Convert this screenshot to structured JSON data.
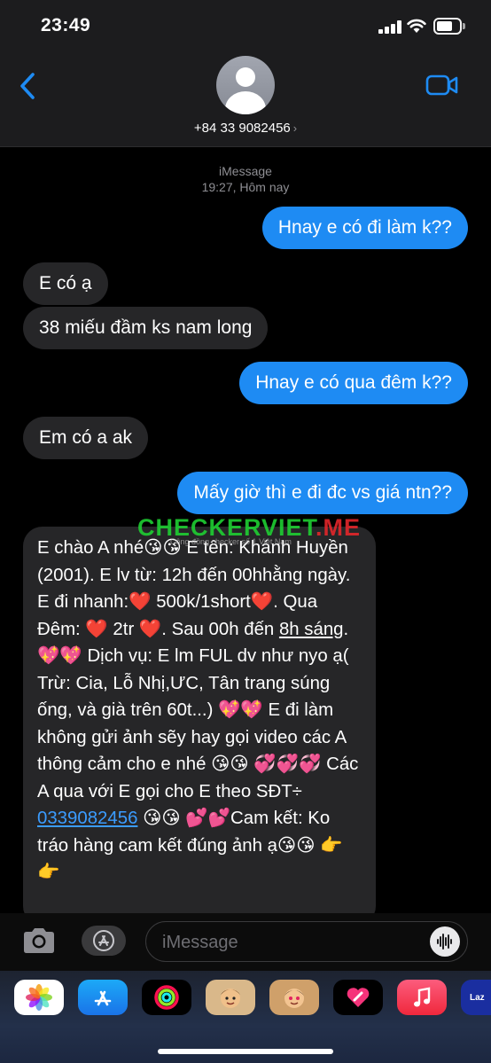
{
  "status": {
    "time": "23:49"
  },
  "header": {
    "phone": "+84 33 9082456",
    "chevron": "›"
  },
  "meta": {
    "service": "iMessage",
    "timestamp": "19:27, Hôm nay"
  },
  "messages": [
    {
      "text": "Hnay e có đi làm k??"
    },
    {
      "text": "E có ạ"
    },
    {
      "text": "38 miếu đầm ks nam long"
    },
    {
      "text": "Hnay e có qua đêm k??"
    },
    {
      "text": "Em có a ak"
    },
    {
      "text": "Mấy giờ thì e đi đc vs giá ntn??"
    }
  ],
  "long_message": {
    "part1": "E chào A nhé😘😘 E tên: Khánh Huyền (2001). E lv từ: 12h đến 00hhằng ngày. E đi nhanh:❤️ 500k/1short❤️. Qua Đêm: ❤️ 2tr ❤️. Sau 00h đến ",
    "underlined": "8h sáng",
    "part2": ". 💖💖 Dịch vụ: E lm FUL dv như nyo ạ( Trừ: Cia, Lỗ Nhị,ƯC, Tân trang súng ống, và già trên 60t...) 💖💖 E đi làm không gửi ảnh sẽy hay gọi video các A thông cảm cho e nhé 😘😘 💞💞💞 Các A qua với E gọi cho E theo SĐT÷ ",
    "phone": "0339082456",
    "part3": " 😘😘 💕💕Cam kết: Ko tráo hàng cam kết đúng ảnh ạ😘😘 👉👉"
  },
  "watermark": {
    "part1": "CHECKERVIET",
    "part2": ".ME",
    "sub": "Công đồng checker số 1 Việt Nam"
  },
  "input": {
    "placeholder": "iMessage"
  },
  "dock_apps": [
    "photos-icon",
    "app-store-icon",
    "activity-icon",
    "memoji-icon",
    "memoji-2-icon",
    "digital-touch-icon",
    "music-icon",
    "lazada-icon"
  ],
  "dock_labels": {
    "lazada": "Laz"
  },
  "colors": {
    "outgoing": "#1e8bf3",
    "incoming": "#262628",
    "link": "#3b9cff",
    "watermark_green": "#1fcf32",
    "watermark_red": "#e3262b"
  }
}
